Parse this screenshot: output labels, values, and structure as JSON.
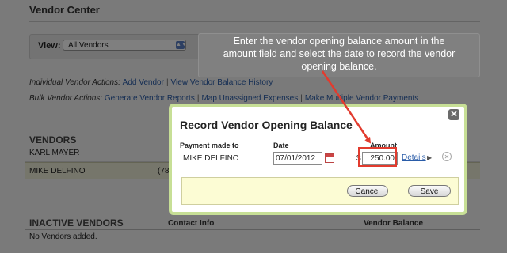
{
  "page": {
    "title": "Vendor Center",
    "view_label": "View:",
    "view_selected": "All Vendors",
    "individual_label": "Individual Vendor Actions:",
    "individual_links": [
      "Add Vendor",
      "View Vendor Balance History"
    ],
    "bulk_label": "Bulk Vendor Actions:",
    "bulk_links": [
      "Generate Vendor Reports",
      "Map Unassigned Expenses",
      "Make Multiple Vendor Payments"
    ],
    "vendors_heading": "VENDORS",
    "vendors": [
      {
        "name": "KARL MAYER",
        "partial": ""
      },
      {
        "name": "MIKE DELFINO",
        "partial": "(78"
      }
    ],
    "inactive_heading": "INACTIVE VENDORS",
    "col_contact": "Contact Info",
    "col_balance": "Vendor Balance",
    "no_vendors": "No Vendors added."
  },
  "tooltip": {
    "line1": "Enter the vendor opening balance amount in the",
    "line2": "amount field and select the date to record the vendor",
    "line3": "opening balance."
  },
  "modal": {
    "title": "Record Vendor Opening Balance",
    "close_icon": "close-icon",
    "payment_label": "Payment made to",
    "payee": "MIKE DELFINO",
    "date_label": "Date",
    "date_value": "07/01/2012",
    "amount_label": "Amount",
    "currency": "$",
    "amount_value": "250.00",
    "details_label": "Details",
    "cancel_label": "Cancel",
    "save_label": "Save"
  },
  "colors": {
    "annotation_arrow": "#e23b2e",
    "modal_border": "#c7df96",
    "footer_bg": "#fcfcd4",
    "link": "#2a5ca8"
  }
}
